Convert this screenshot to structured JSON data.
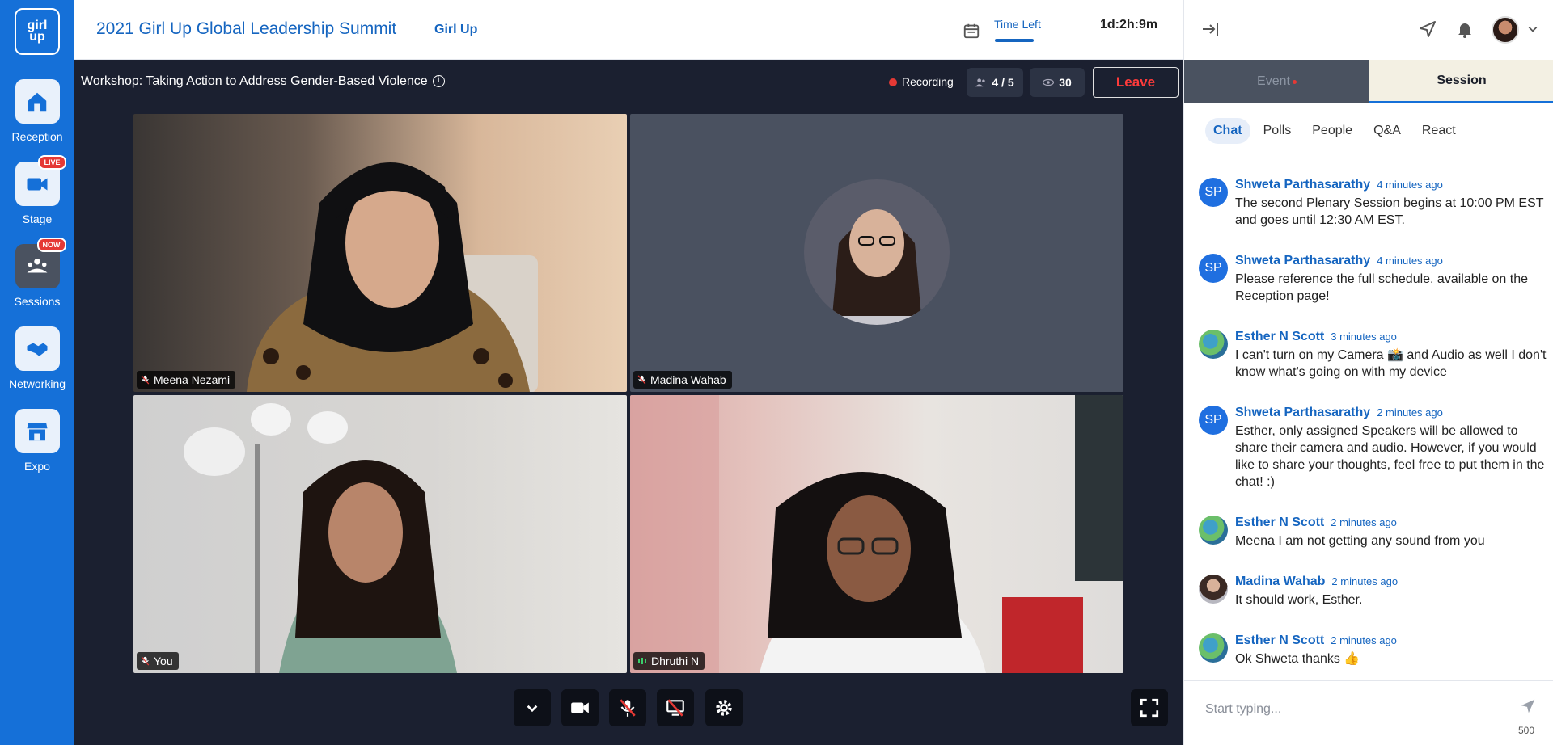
{
  "rail": {
    "logo_text_line1": "girl",
    "logo_text_line2": "up",
    "items": [
      {
        "label": "Reception",
        "badge": ""
      },
      {
        "label": "Stage",
        "badge": "LIVE"
      },
      {
        "label": "Sessions",
        "badge": "NOW"
      },
      {
        "label": "Networking",
        "badge": ""
      },
      {
        "label": "Expo",
        "badge": ""
      }
    ]
  },
  "header": {
    "title": "2021 Girl Up Global Leadership Summit",
    "org": "Girl Up",
    "time_left_label": "Time Left",
    "countdown": "1d:2h:9m"
  },
  "session": {
    "title": "Workshop: Taking Action to Address Gender-Based Violence",
    "info_icon": "i",
    "recording_label": "Recording",
    "speakers_count": "4 / 5",
    "viewers_count": "30",
    "leave_label": "Leave"
  },
  "videos": [
    {
      "name": "Meena Nezami",
      "mic": "off"
    },
    {
      "name": "Madina Wahab",
      "mic": "off"
    },
    {
      "name": "You",
      "mic": "off"
    },
    {
      "name": "Dhruthi N",
      "mic": "on"
    }
  ],
  "controls": [
    "chevron-down-icon",
    "camera-icon",
    "mic-off-icon",
    "screen-share-off-icon",
    "settings-icon",
    "fullscreen-icon"
  ],
  "panel": {
    "tab_event": "Event",
    "tab_session": "Session",
    "subtabs": [
      "Chat",
      "Polls",
      "People",
      "Q&A",
      "React"
    ],
    "messages": [
      {
        "initials": "SP",
        "name": "Shweta Parthasarathy",
        "time": "4 minutes ago",
        "text": "The second Plenary Session begins at 10:00 PM EST and goes until 12:30 AM EST."
      },
      {
        "initials": "SP",
        "name": "Shweta Parthasarathy",
        "time": "4 minutes ago",
        "text": "Please reference the full schedule, available on the Reception page!"
      },
      {
        "initials": "",
        "name": "Esther N Scott",
        "time": "3 minutes ago",
        "text": "I can't turn on my Camera 📸 and Audio as well I don't know what's going on with my device"
      },
      {
        "initials": "SP",
        "name": "Shweta Parthasarathy",
        "time": "2 minutes ago",
        "text": "Esther, only assigned Speakers will be allowed to share their camera and audio. However, if you would like to share your thoughts, feel free to put them in the chat! :)"
      },
      {
        "initials": "",
        "name": "Esther N Scott",
        "time": "2 minutes ago",
        "text": "Meena I am not getting any sound from you"
      },
      {
        "initials": "",
        "name": "Madina Wahab",
        "time": "2 minutes ago",
        "text": "It should work, Esther."
      },
      {
        "initials": "",
        "name": "Esther N Scott",
        "time": "2 minutes ago",
        "text": "Ok Shweta thanks 👍"
      }
    ],
    "composer_placeholder": "Start typing...",
    "char_limit": "500"
  },
  "colors": {
    "brand": "#1570d8",
    "link": "#1565c0",
    "danger": "#ff3b3b",
    "stage_bg": "#1b2030"
  }
}
